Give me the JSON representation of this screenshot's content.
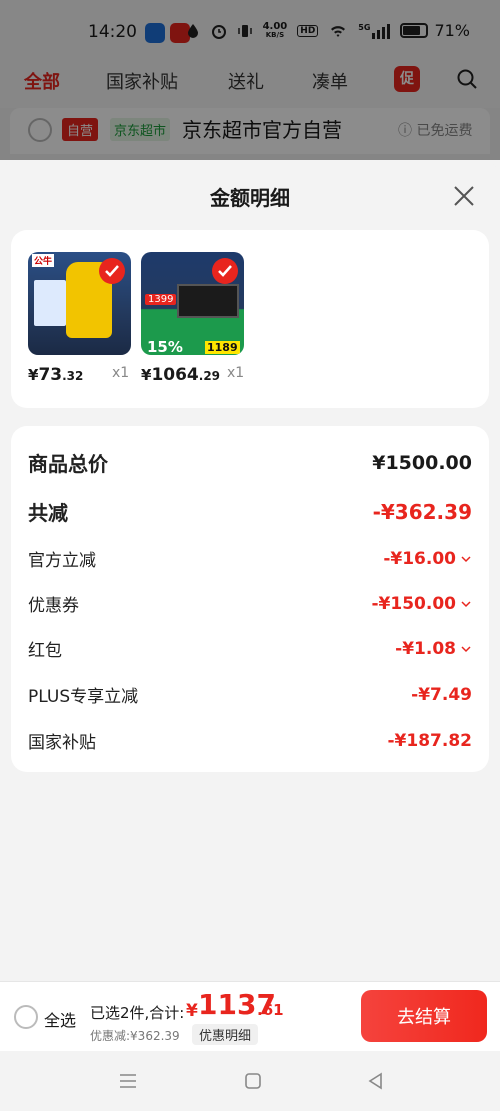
{
  "status_bar": {
    "time": "14:20",
    "network_speed": "4.00",
    "network_unit": "KB/S",
    "hd": "HD",
    "signal_label": "5G",
    "battery": "71%",
    "app_badge_1_color": "#1e6fd9",
    "app_badge_2_color": "#e8251e"
  },
  "top_nav": {
    "tabs": [
      "全部",
      "国家补贴",
      "送礼",
      "凑单"
    ],
    "active_index": 0,
    "promo_label": "促"
  },
  "store_row": {
    "tag_self": "自营",
    "tag_market": "京东超市",
    "store_name": "京东超市官方自营",
    "shipping": "已免运费"
  },
  "sheet": {
    "title": "金额明细",
    "products": [
      {
        "price_symbol": "¥",
        "price_int": "73",
        "price_dec": ".32",
        "qty": "x1",
        "thumb_label": "公牛"
      },
      {
        "price_symbol": "¥",
        "price_int": "1064",
        "price_dec": ".29",
        "qty": "x1",
        "thumb_label_1": "1399",
        "thumb_label_2": "15%",
        "thumb_label_3": "1189"
      }
    ],
    "summary": {
      "total_label": "商品总价",
      "total_value": "¥1500.00",
      "reduce_label": "共减",
      "reduce_value": "-¥362.39",
      "items": [
        {
          "label": "官方立减",
          "value": "-¥16.00",
          "expandable": true
        },
        {
          "label": "优惠券",
          "value": "-¥150.00",
          "expandable": true
        },
        {
          "label": "红包",
          "value": "-¥1.08",
          "expandable": true
        },
        {
          "label": "PLUS专享立减",
          "value": "-¥7.49",
          "expandable": false
        },
        {
          "label": "国家补贴",
          "value": "-¥187.82",
          "expandable": false
        }
      ]
    }
  },
  "checkout": {
    "select_all": "全选",
    "selected_text": "已选2件,合计:",
    "total_symbol": "¥",
    "total_int": "1137",
    "total_dec": ".61",
    "discount_text": "优惠减:¥362.39",
    "detail_chip": "优惠明细",
    "checkout_button": "去结算"
  },
  "colors": {
    "accent": "#e8251e",
    "green": "#1a9b3a"
  }
}
